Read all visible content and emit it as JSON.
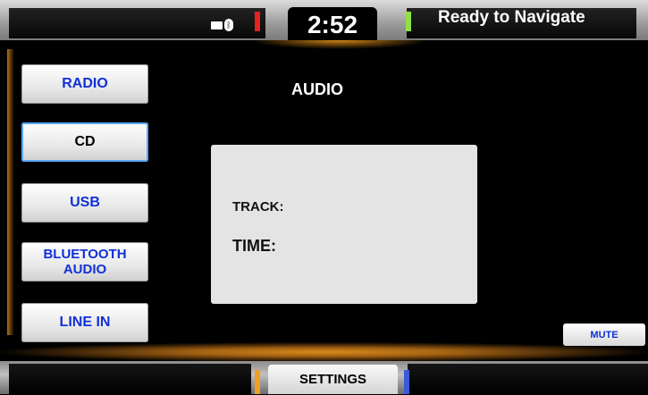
{
  "status_bar": {
    "clock": "2:52",
    "navigation_status": "Ready to Navigate",
    "icons": [
      "mail-icon",
      "bluetooth-icon"
    ]
  },
  "sources": [
    {
      "label": "RADIO",
      "active": false
    },
    {
      "label": "CD",
      "active": true
    },
    {
      "label": "USB",
      "active": false
    },
    {
      "label": "BLUETOOTH AUDIO",
      "active": false
    },
    {
      "label": "LINE IN",
      "active": false
    }
  ],
  "screen_title": "AUDIO",
  "info_panel": {
    "track_label": "TRACK:",
    "time_label": "TIME:"
  },
  "mute_label": "MUTE",
  "bottom_bar": {
    "settings_label": "SETTINGS"
  },
  "colors": {
    "accent_blue": "#1030d8",
    "ambient_orange": "#d88a1a",
    "indicator_red": "#e32222",
    "indicator_green": "#8fe046",
    "indicator_orange": "#f0a020",
    "indicator_blue": "#3a5ad8"
  }
}
